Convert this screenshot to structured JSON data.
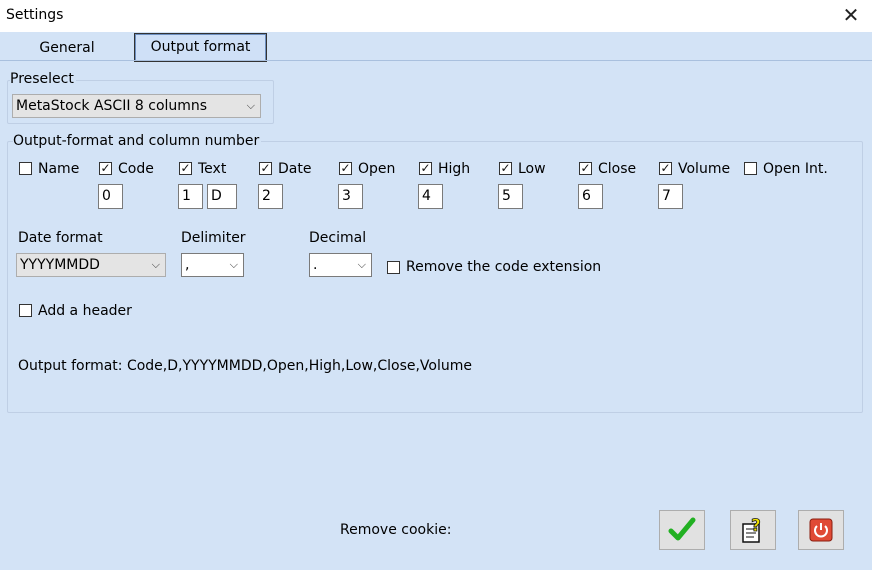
{
  "window": {
    "title": "Settings"
  },
  "tabs": [
    {
      "label": "General",
      "active": false
    },
    {
      "label": "Output format",
      "active": true
    }
  ],
  "preselect": {
    "label": "Preselect",
    "value": "MetaStock ASCII 8 columns"
  },
  "output_group": {
    "label": "Output-format and column number",
    "columns": [
      {
        "label": "Name",
        "checked": false,
        "numbers": []
      },
      {
        "label": "Code",
        "checked": true,
        "numbers": [
          "0"
        ]
      },
      {
        "label": "Text",
        "checked": true,
        "numbers": [
          "1",
          "D"
        ]
      },
      {
        "label": "Date",
        "checked": true,
        "numbers": [
          "2"
        ]
      },
      {
        "label": "Open",
        "checked": true,
        "numbers": [
          "3"
        ]
      },
      {
        "label": "High",
        "checked": true,
        "numbers": [
          "4"
        ]
      },
      {
        "label": "Low",
        "checked": true,
        "numbers": [
          "5"
        ]
      },
      {
        "label": "Close",
        "checked": true,
        "numbers": [
          "6"
        ]
      },
      {
        "label": "Volume",
        "checked": true,
        "numbers": [
          "7"
        ]
      },
      {
        "label": "Open Int.",
        "checked": false,
        "numbers": []
      }
    ],
    "date_format": {
      "label": "Date format",
      "value": "YYYYMMDD"
    },
    "delimiter": {
      "label": "Delimiter",
      "value": ","
    },
    "decimal": {
      "label": "Decimal",
      "value": "."
    },
    "remove_code_ext": {
      "label": "Remove the code extension",
      "checked": false
    },
    "add_header": {
      "label": "Add a header",
      "checked": false
    },
    "output_format_text": "Output format: Code,D,YYYYMMDD,Open,High,Low,Close,Volume"
  },
  "footer": {
    "remove_cookie_label": "Remove cookie:"
  },
  "colors": {
    "background": "#d3e3f6",
    "ok_check": "#22b022",
    "power_button": "#e04a35",
    "help_yellow": "#f2e300"
  },
  "icons": [
    "close-icon",
    "checkmark-icon",
    "help-icon",
    "power-icon",
    "chevron-down-icon"
  ]
}
